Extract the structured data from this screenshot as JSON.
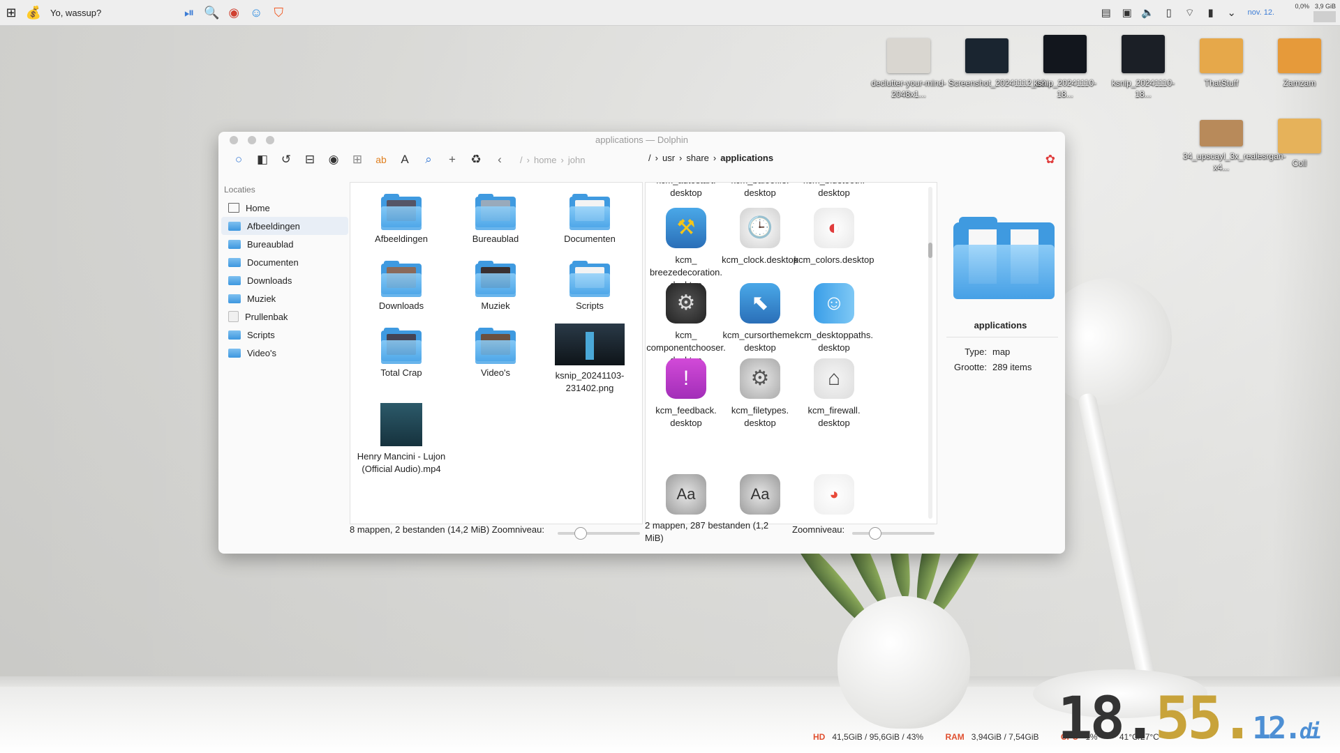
{
  "panel": {
    "title": "Yo, wassup?",
    "date": "nov. 12.",
    "cpu_mem_top": "0,0%",
    "mem_top": "3,9 GiB",
    "icons": [
      "kde-icon",
      "money-bag-icon"
    ],
    "launchers": [
      "play-pause-icon",
      "document-viewer-icon",
      "screenshot-icon",
      "finder-icon",
      "brave-icon"
    ],
    "tray": [
      "clipboard-icon",
      "window-icon",
      "volume-icon",
      "phone-icon",
      "wifi-icon",
      "battery-icon",
      "chevron-down-icon"
    ]
  },
  "desktop": {
    "icons": [
      {
        "label": "declutter-your-mind-2048x1...",
        "color": "#d9d6d0"
      },
      {
        "label": "Screenshot_20241112_18...",
        "color": "#1a2530"
      },
      {
        "label": "ksnip_20241110-18...",
        "color": "#12161d"
      },
      {
        "label": "ksnip_20241110-18...",
        "color": "#1b1f26"
      },
      {
        "label": "ThatStuff",
        "color": "#e6a84a"
      },
      {
        "label": "Zamzam",
        "color": "#e69a3a"
      },
      {
        "label": "34_upscayl_3x_realesrgan-x4...",
        "color": "#b88a5a"
      },
      {
        "label": "Coll",
        "color": "#e6b25a"
      }
    ]
  },
  "window": {
    "title": "applications — Dolphin",
    "breadcrumbs_left": [
      "/",
      "home",
      "john"
    ],
    "breadcrumbs_right": [
      "/",
      "usr",
      "share",
      "applications"
    ],
    "sidebar": {
      "header": "Locaties",
      "items": [
        "Home",
        "Afbeeldingen",
        "Bureaublad",
        "Documenten",
        "Downloads",
        "Muziek",
        "Prullenbak",
        "Scripts",
        "Video's"
      ]
    },
    "pane1": {
      "items": [
        "Afbeeldingen",
        "Bureaublad",
        "Documenten",
        "Downloads",
        "Muziek",
        "Scripts",
        "Total Crap",
        "Video's",
        "ksnip_20241103-231402.png",
        "Henry Mancini - Lujon (Official Audio).mp4"
      ],
      "status": "8 mappen, 2 bestanden (14,2 MiB) Zoomniveau:",
      "zoom": 0.2
    },
    "pane2": {
      "items": [
        "kcm_autostart.desktop",
        "kcm_baloofile.desktop",
        "kcm_bluetooth.desktop",
        "kcm_breezedecoration.desktop",
        "kcm_clock.desktop",
        "kcm_colors.desktop",
        "kcm_componentchooser.desktop",
        "kcm_cursortheme.desktop",
        "kcm_desktoppaths.desktop",
        "kcm_feedback.desktop",
        "kcm_filetypes.desktop",
        "kcm_firewall.desktop"
      ],
      "item_lines": [
        [
          "kcm_autostart.",
          "desktop"
        ],
        [
          "kcm_baloofile.",
          "desktop"
        ],
        [
          "kcm_bluetooth.",
          "desktop"
        ],
        [
          "kcm_",
          "breezedecoration.",
          "desktop"
        ],
        [
          "kcm_clock.desktop"
        ],
        [
          "kcm_colors.desktop"
        ],
        [
          "kcm_",
          "componentchooser.",
          "desktop"
        ],
        [
          "kcm_cursortheme.",
          "desktop"
        ],
        [
          "kcm_desktoppaths.",
          "desktop"
        ],
        [
          "kcm_feedback.",
          "desktop"
        ],
        [
          "kcm_filetypes.",
          "desktop"
        ],
        [
          "kcm_firewall.",
          "desktop"
        ]
      ],
      "status": "2 mappen, 287 bestanden (1,2 MiB)",
      "zoom_label": "Zoomniveau:",
      "zoom": 0.2
    },
    "info": {
      "name": "applications",
      "type_key": "Type:",
      "type_val": "map",
      "size_key": "Grootte:",
      "size_val": "289 items"
    }
  },
  "bottom": {
    "clock": {
      "h": "18.",
      "m": "55.",
      "s": "12.",
      "day": "di"
    },
    "hd_label": "HD",
    "hd": "41,5GiB / 95,6GiB / 43%",
    "ram_label": "RAM",
    "ram": "3,94GiB / 7,54GiB",
    "cpu_label": "CPU",
    "cpu": "1%",
    "temp": "41°C/27°C"
  }
}
